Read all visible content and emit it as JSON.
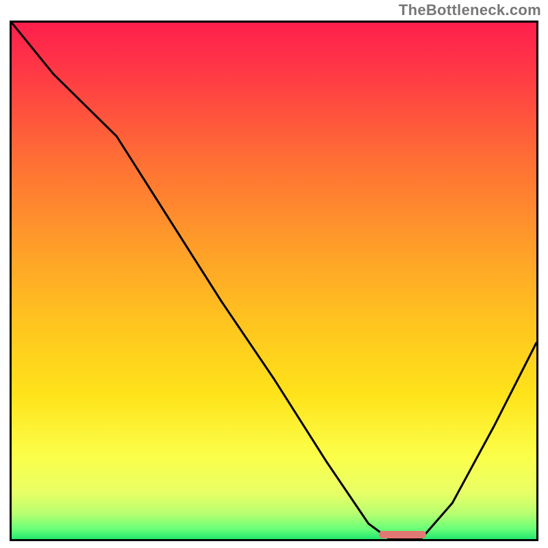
{
  "watermark": "TheBottleneck.com",
  "colors": {
    "border": "#000000",
    "curve": "#000000",
    "marker": "#e27874",
    "watermark_text": "#777777",
    "gradient": {
      "top": "#ff2a4a",
      "upper_mid": "#ff8a2a",
      "mid": "#ffd92a",
      "lower_mid": "#f6ff6a",
      "bottom": "#2aff7a"
    }
  },
  "chart_data": {
    "type": "line",
    "title": "",
    "xlabel": "",
    "ylabel": "",
    "xlim": [
      0,
      1
    ],
    "ylim": [
      0,
      1
    ],
    "series": [
      {
        "name": "bottleneck-curve",
        "x": [
          0.0,
          0.08,
          0.2,
          0.3,
          0.4,
          0.5,
          0.6,
          0.68,
          0.72,
          0.78,
          0.84,
          0.92,
          1.0
        ],
        "values": [
          1.0,
          0.9,
          0.78,
          0.62,
          0.46,
          0.31,
          0.15,
          0.03,
          0.0,
          0.0,
          0.07,
          0.22,
          0.38
        ]
      }
    ],
    "marker": {
      "x_start": 0.7,
      "x_end": 0.79,
      "y": 0.006
    },
    "annotations": []
  }
}
